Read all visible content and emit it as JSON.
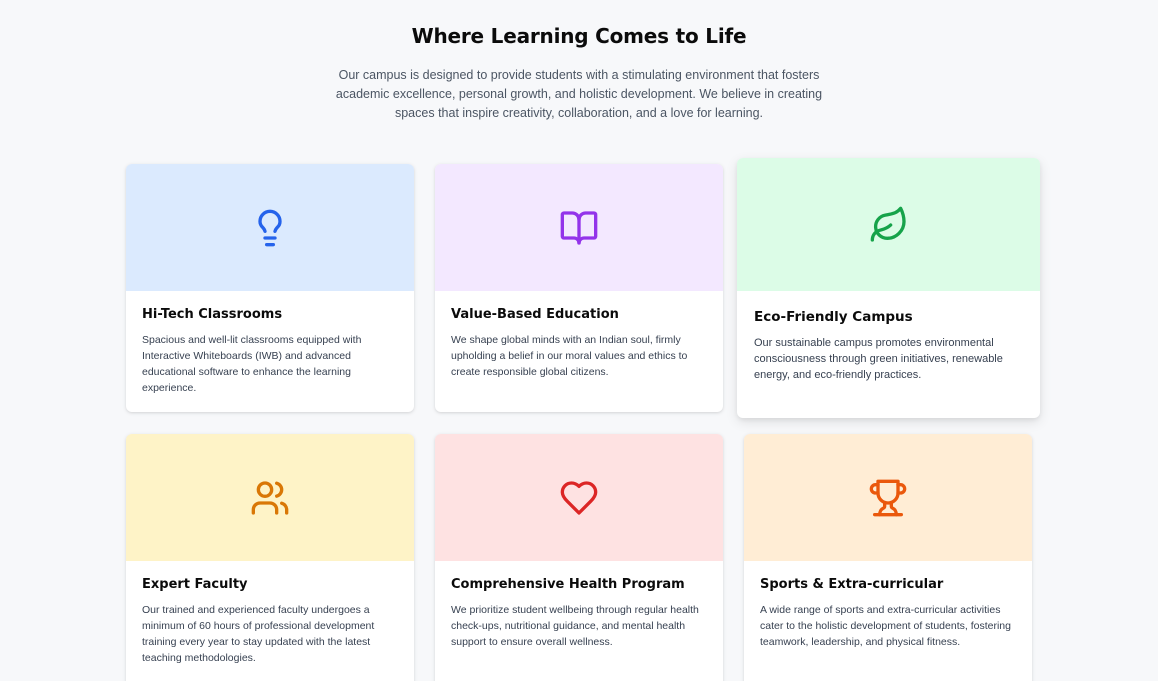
{
  "header": {
    "title": "Where Learning Comes to Life",
    "subtitle": "Our campus is designed to provide students with a stimulating environment that fosters academic excellence, personal growth, and holistic development. We believe in creating spaces that inspire creativity, collaboration, and a love for learning."
  },
  "features": [
    {
      "title": "Hi-Tech Classrooms",
      "description": "Spacious and well-lit classrooms equipped with Interactive Whiteboards (IWB) and advanced educational software to enhance the learning experience.",
      "icon": "lightbulb-icon",
      "banner_color": "#dbeafe",
      "icon_color": "#2563eb"
    },
    {
      "title": "Value-Based Education",
      "description": "We shape global minds with an Indian soul, firmly upholding a belief in our moral values and ethics to create responsible global citizens.",
      "icon": "book-open-icon",
      "banner_color": "#f3e8ff",
      "icon_color": "#9333ea"
    },
    {
      "title": "Eco-Friendly Campus",
      "description": "Our sustainable campus promotes environmental consciousness through green initiatives, renewable energy, and eco-friendly practices.",
      "icon": "leaf-icon",
      "banner_color": "#dcfce7",
      "icon_color": "#16a34a"
    },
    {
      "title": "Expert Faculty",
      "description": "Our trained and experienced faculty undergoes a minimum of 60 hours of professional development training every year to stay updated with the latest teaching methodologies.",
      "icon": "users-icon",
      "banner_color": "#fef3c7",
      "icon_color": "#d97706"
    },
    {
      "title": "Comprehensive Health Program",
      "description": "We prioritize student wellbeing through regular health check-ups, nutritional guidance, and mental health support to ensure overall wellness.",
      "icon": "heart-icon",
      "banner_color": "#fee2e2",
      "icon_color": "#dc2626"
    },
    {
      "title": "Sports & Extra-curricular",
      "description": "A wide range of sports and extra-curricular activities cater to the holistic development of students, fostering teamwork, leadership, and physical fitness.",
      "icon": "trophy-icon",
      "banner_color": "#ffedd5",
      "icon_color": "#ea580c"
    }
  ]
}
